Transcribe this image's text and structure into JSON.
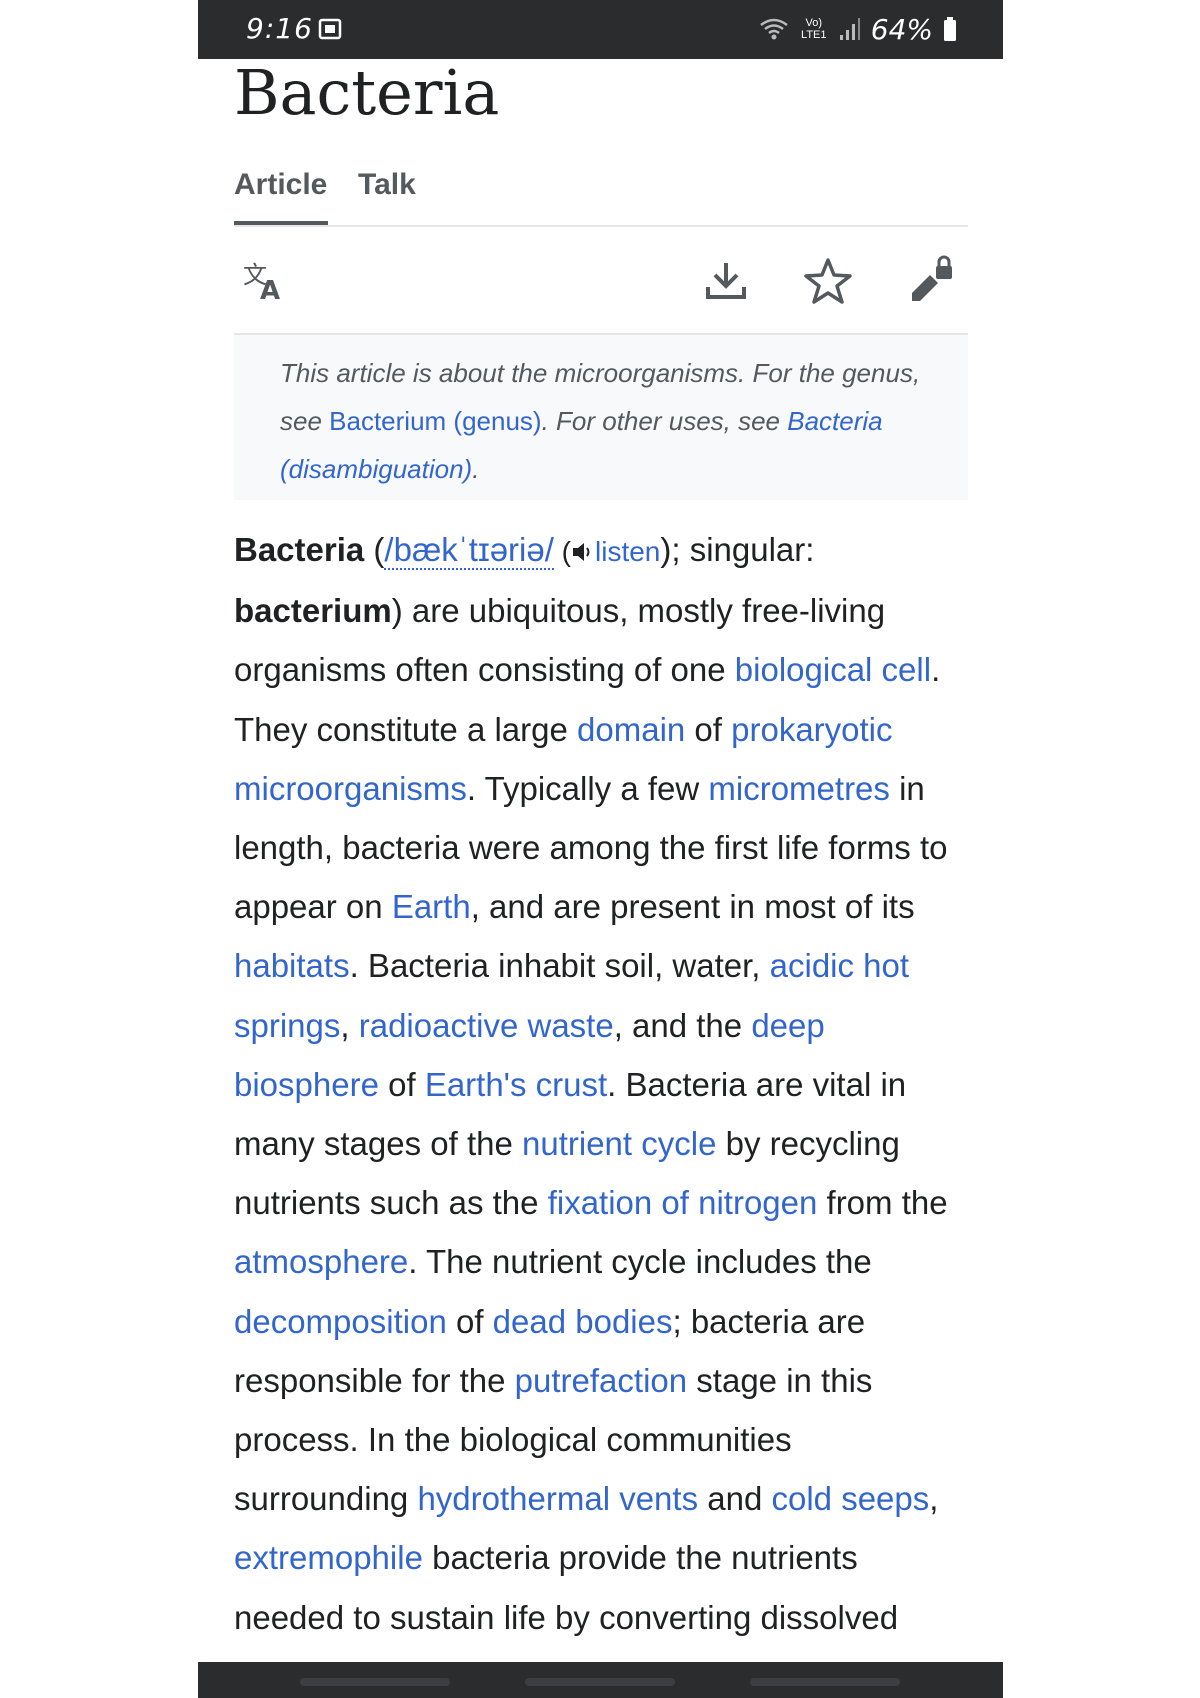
{
  "status_bar": {
    "time": "9:16",
    "signal_text": "Vo) LTE1",
    "battery_percent": "64%"
  },
  "article": {
    "title": "Bacteria",
    "tabs": [
      {
        "label": "Article",
        "active": true
      },
      {
        "label": "Talk",
        "active": false
      }
    ]
  },
  "toolbar": {
    "icons": [
      "language-icon",
      "download-icon",
      "star-icon",
      "edit-locked-icon"
    ]
  },
  "hatnote": {
    "t1": "This article is about the microorganisms. For the genus, see ",
    "link1": "Bacterium (genus)",
    "t2": ". For other uses, see ",
    "link2": "Bacteria (disambiguation)",
    "t3": "."
  },
  "body": {
    "s1_bold": "Bacteria",
    "s2": " (",
    "ipa": "/bækˈtɪəriə/",
    "s3": " (",
    "listen": "listen",
    "s4": "); singular: ",
    "s5_bold": "bacterium",
    "s6": ") are ubiquitous, mostly free-living organisms often consisting of one ",
    "l_biological_cell": "biological cell",
    "s7": ". They constitute a large ",
    "l_domain": "domain",
    "s8": " of ",
    "l_prokaryotic": "prokaryotic microorganisms",
    "s9": ". Typically a few ",
    "l_micrometres": "micrometres",
    "s10": " in length, bacteria were among the first life forms to appear on ",
    "l_earth": "Earth",
    "s11": ", and are present in most of its ",
    "l_habitats": "habitats",
    "s12": ". Bacteria inhabit soil, water, ",
    "l_acidic": "acidic hot springs",
    "s13": ", ",
    "l_radioactive": "radioactive waste",
    "s14": ", and the ",
    "l_biosphere": "deep biosphere",
    "s15": " of ",
    "l_crust": "Earth's crust",
    "s16": ". Bacteria are vital in many stages of the ",
    "l_nutrient_cycle": "nutrient cycle",
    "s17": " by recycling nutrients such as the ",
    "l_fixation": "fixation of nitrogen",
    "s18": " from the ",
    "l_atmosphere": "atmosphere",
    "s19": ". The nutrient cycle includes the ",
    "l_decomposition": "decomposition",
    "s20": " of ",
    "l_dead_bodies": "dead bodies",
    "s21": "; bacteria are responsible for the ",
    "l_putrefaction": "putrefaction",
    "s22": " stage in this process. In the biological communities surrounding ",
    "l_vents": "hydrothermal vents",
    "s23": " and ",
    "l_seeps": "cold seeps",
    "s24": ", ",
    "l_extremophile": "extremophile",
    "s25": " bacteria provide the nutrients needed to sustain life by converting dissolved"
  },
  "colors": {
    "link": "#3366cc",
    "text": "#202122",
    "status_bar": "#2b2c2e",
    "hatnote_bg": "#f8f9fa"
  }
}
